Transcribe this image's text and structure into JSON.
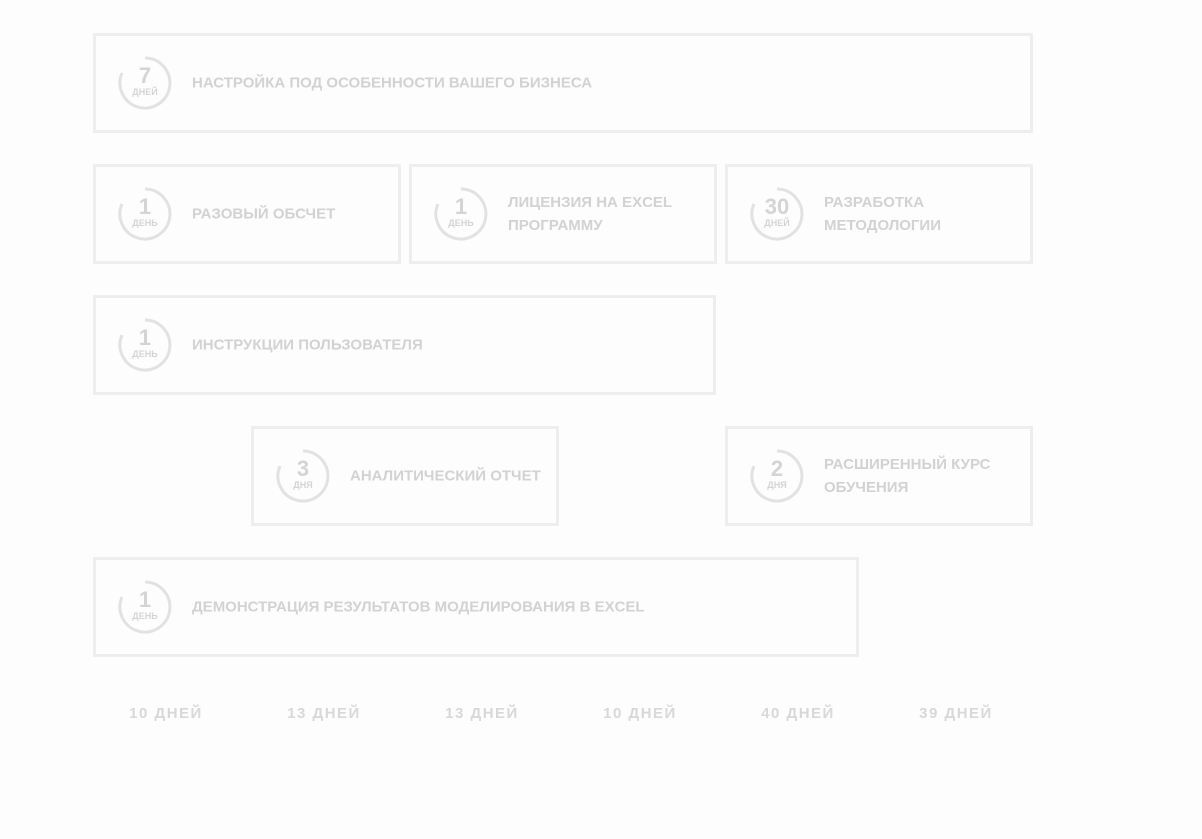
{
  "stages": [
    {
      "days": "7",
      "unit": "ДНЕЙ",
      "label": "НАСТРОЙКА ПОД ОСОБЕННОСТИ ВАШЕГО БИЗНЕСА"
    },
    {
      "days": "1",
      "unit": "ДЕНЬ",
      "label": "РАЗОВЫЙ ОБСЧЕТ"
    },
    {
      "days": "1",
      "unit": "ДЕНЬ",
      "label": "ЛИЦЕНЗИЯ НА EXCEL ПРОГРАММУ"
    },
    {
      "days": "30",
      "unit": "ДНЕЙ",
      "label": "РАЗРАБОТКА МЕТОДОЛОГИИ"
    },
    {
      "days": "1",
      "unit": "ДЕНЬ",
      "label": "ИНСТРУКЦИИ ПОЛЬЗОВАТЕЛЯ"
    },
    {
      "days": "3",
      "unit": "ДНЯ",
      "label": "АНАЛИТИЧЕСКИЙ ОТЧЕТ"
    },
    {
      "days": "2",
      "unit": "ДНЯ",
      "label": "РАСШИРЕННЫЙ КУРС ОБУЧЕНИЯ"
    },
    {
      "days": "1",
      "unit": "ДЕНЬ",
      "label": "ДЕМОНСТРАЦИЯ РЕЗУЛЬТАТОВ МОДЕЛИРОВАНИЯ В EXCEL"
    }
  ],
  "totals": [
    "10 ДНЕЙ",
    "13 ДНЕЙ",
    "13 ДНЕЙ",
    "10 ДНЕЙ",
    "40 ДНЕЙ",
    "39 ДНЕЙ"
  ],
  "colors": {
    "border": "#eeeeee",
    "text": "#d2d2d2",
    "ring": "#e2e2e2"
  }
}
